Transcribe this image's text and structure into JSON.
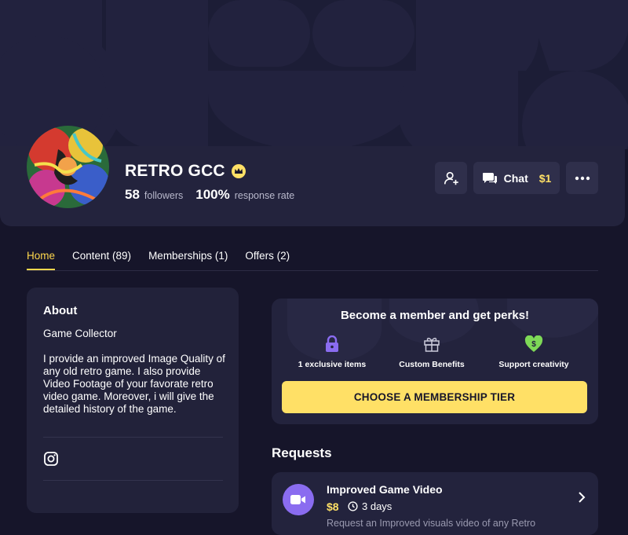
{
  "profile": {
    "name": "RETRO GCC",
    "followers_count": "58",
    "followers_label": "followers",
    "response_rate": "100%",
    "response_label": "response rate"
  },
  "actions": {
    "chat_label": "Chat",
    "chat_price": "$1"
  },
  "tabs": [
    {
      "label": "Home",
      "active": true
    },
    {
      "label": "Content (89)",
      "active": false
    },
    {
      "label": "Memberships (1)",
      "active": false
    },
    {
      "label": "Offers (2)",
      "active": false
    }
  ],
  "about": {
    "title": "About",
    "subtitle": "Game Collector",
    "description": "I provide an improved Image Quality of any old retro game. I also provide Video Footage of your favorate retro video game. Moreover, i will give the detailed history of the game."
  },
  "membership": {
    "title": "Become a member and get perks!",
    "perks": [
      {
        "label": "1 exclusive items",
        "icon": "lock-icon"
      },
      {
        "label": "Custom Benefits",
        "icon": "gift-icon"
      },
      {
        "label": "Support creativity",
        "icon": "heart-dollar-icon"
      }
    ],
    "button_label": "CHOOSE A MEMBERSHIP TIER"
  },
  "requests": {
    "title": "Requests",
    "items": [
      {
        "title": "Improved Game Video",
        "price": "$8",
        "duration": "3 days",
        "description": "Request an Improved visuals video of any Retro"
      }
    ]
  },
  "colors": {
    "accent": "#ffe066",
    "background": "#16152a",
    "card": "#23233d",
    "purple": "#8a6cf0",
    "green": "#7ed957"
  }
}
